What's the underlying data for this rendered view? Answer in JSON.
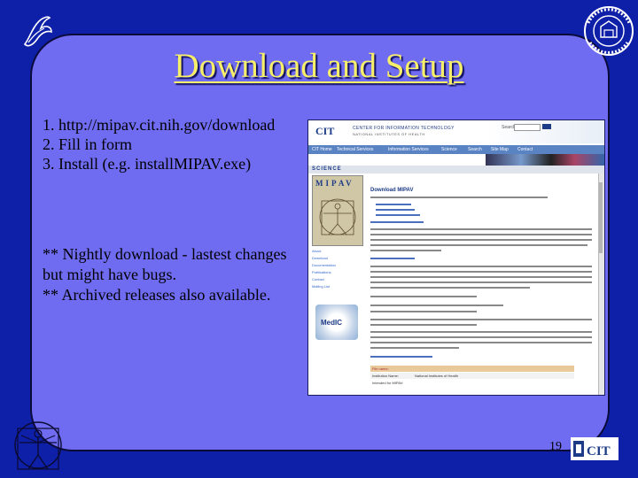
{
  "slide": {
    "title": "Download and Setup",
    "steps": [
      "1. http://mipav.cit.nih.gov/download",
      "2. Fill in form",
      "3. Install (e.g. installMIPAV.exe)"
    ],
    "notes": [
      "** Nightly download -  lastest changes but might have bugs.",
      "** Archived releases also available."
    ],
    "page_number": "19"
  },
  "screenshot": {
    "cit_mark": "CIT",
    "center_name": "CENTER FOR INFORMATION TECHNOLOGY",
    "center_sub": "NATIONAL INSTITUTES OF HEALTH",
    "search_label": "Search",
    "nav": [
      "CIT Home",
      "Technical Services",
      "Information Services",
      "Science",
      "Search",
      "Site Map",
      "Contact"
    ],
    "section": "SCIENCE",
    "mipav_word": "MIPAV",
    "page_title": "Download MIPAV",
    "left_links": [
      "About",
      "Download",
      "Documentation",
      "Publications",
      "Contact",
      "Mailing List"
    ],
    "medic_word": "MedIC",
    "table_rows": [
      {
        "label": "File name:",
        "value": ""
      },
      {
        "label": "Institution Name:",
        "value": "National Institutes of Health"
      },
      {
        "label": "Intended for MIPAV:",
        "value": ""
      }
    ]
  },
  "colors": {
    "background": "#0e1fa8",
    "panel": "#6f6cf2",
    "title": "#f7ee6a"
  }
}
